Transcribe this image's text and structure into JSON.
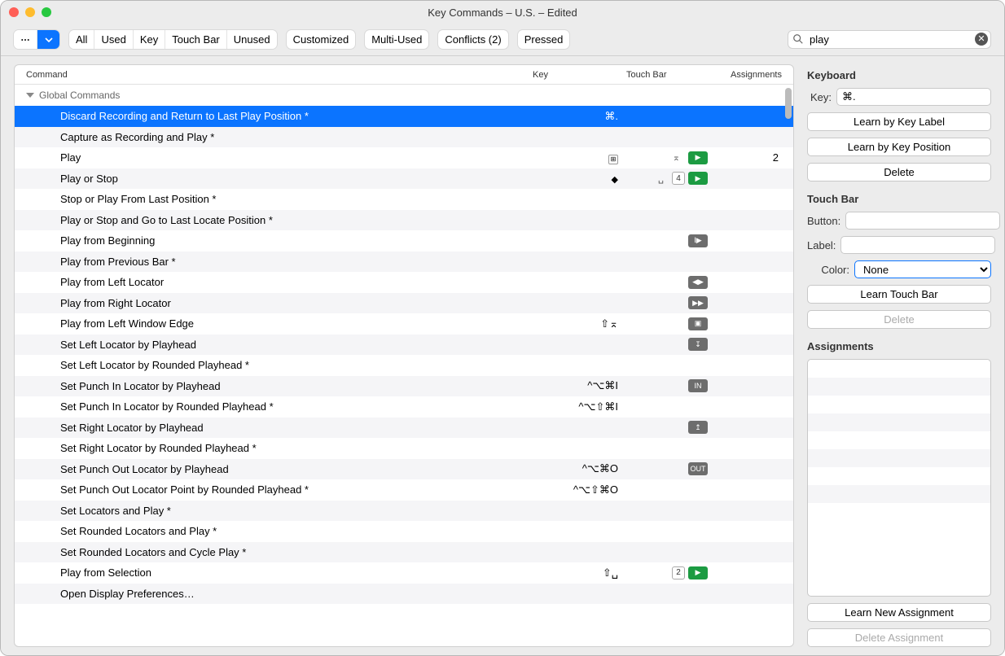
{
  "window": {
    "title": "Key Commands – U.S. – Edited"
  },
  "toolbar": {
    "filters": [
      "All",
      "Used",
      "Key",
      "Touch Bar",
      "Unused"
    ],
    "buttons": [
      "Customized",
      "Multi-Used",
      "Conflicts (2)",
      "Pressed"
    ]
  },
  "search": {
    "placeholder": "Search",
    "value": "play"
  },
  "table": {
    "cols": {
      "command": "Command",
      "key": "Key",
      "touch": "Touch Bar",
      "assign": "Assignments"
    },
    "group": "Global Commands",
    "rows": [
      {
        "cmd": "Discard Recording and Return to Last Play Position *",
        "key": "⌘.",
        "t": "",
        "a": "",
        "sel": true
      },
      {
        "cmd": "Capture as Recording and Play *",
        "key": "",
        "t": "",
        "a": ""
      },
      {
        "cmd": "Play",
        "key": "⊞",
        "kicon": true,
        "t": "▶",
        "tcolor": "green",
        "a": "2",
        "pretouch": "⌅"
      },
      {
        "cmd": "Play or Stop",
        "key": "",
        "kglyph": "◆",
        "t": "▶",
        "tcolor": "green",
        "tnum": "4",
        "a": "",
        "pretouch": "␣"
      },
      {
        "cmd": "Stop or Play From Last Position *",
        "key": "",
        "t": "",
        "a": ""
      },
      {
        "cmd": "Play or Stop and Go to Last Locate Position *",
        "key": "",
        "t": "",
        "a": ""
      },
      {
        "cmd": "Play from Beginning",
        "key": "",
        "t": "I▶",
        "tcolor": "gray",
        "a": ""
      },
      {
        "cmd": "Play from Previous Bar *",
        "key": "",
        "t": "",
        "a": ""
      },
      {
        "cmd": "Play from Left Locator",
        "key": "",
        "t": "◀▶",
        "tcolor": "gray",
        "a": ""
      },
      {
        "cmd": "Play from Right Locator",
        "key": "",
        "t": "▶▶",
        "tcolor": "gray",
        "a": ""
      },
      {
        "cmd": "Play from Left Window Edge",
        "key": "⇧⌅",
        "t": "▣",
        "tcolor": "gray",
        "a": ""
      },
      {
        "cmd": "Set Left Locator by Playhead",
        "key": "",
        "t": "↧",
        "tcolor": "gray",
        "a": ""
      },
      {
        "cmd": "Set Left Locator by Rounded Playhead *",
        "key": "",
        "t": "",
        "a": ""
      },
      {
        "cmd": "Set Punch In Locator by Playhead",
        "key": "^⌥⌘I",
        "t": "IN",
        "tcolor": "gray",
        "a": ""
      },
      {
        "cmd": "Set Punch In Locator by Rounded Playhead *",
        "key": "^⌥⇧⌘I",
        "t": "",
        "a": ""
      },
      {
        "cmd": "Set Right Locator by Playhead",
        "key": "",
        "t": "↥",
        "tcolor": "gray",
        "a": ""
      },
      {
        "cmd": "Set Right Locator by Rounded Playhead *",
        "key": "",
        "t": "",
        "a": ""
      },
      {
        "cmd": "Set Punch Out Locator by Playhead",
        "key": "^⌥⌘O",
        "t": "OUT",
        "tcolor": "gray",
        "a": ""
      },
      {
        "cmd": "Set Punch Out Locator Point by Rounded Playhead *",
        "key": "^⌥⇧⌘O",
        "t": "",
        "a": ""
      },
      {
        "cmd": "Set Locators and Play *",
        "key": "",
        "t": "",
        "a": ""
      },
      {
        "cmd": "Set Rounded Locators and Play *",
        "key": "",
        "t": "",
        "a": ""
      },
      {
        "cmd": "Set Rounded Locators and Cycle Play *",
        "key": "",
        "t": "",
        "a": ""
      },
      {
        "cmd": "Play from Selection",
        "key": "⇧␣",
        "t": "▶",
        "tcolor": "green",
        "tnum": "2",
        "a": ""
      },
      {
        "cmd": "Open Display Preferences…",
        "key": "",
        "t": "",
        "a": ""
      }
    ]
  },
  "side": {
    "keyboard": {
      "title": "Keyboard",
      "key_label": "Key:",
      "key_value": "⌘.",
      "btn_learn_label": "Learn by Key Label",
      "btn_learn_pos": "Learn by Key Position",
      "btn_delete": "Delete"
    },
    "touchbar": {
      "title": "Touch Bar",
      "button_label": "Button:",
      "button_value": "",
      "label_label": "Label:",
      "label_value": "",
      "color_label": "Color:",
      "color_value": "None",
      "btn_learn": "Learn Touch Bar",
      "btn_delete": "Delete"
    },
    "assignments": {
      "title": "Assignments",
      "btn_learn": "Learn New Assignment",
      "btn_delete": "Delete Assignment"
    }
  }
}
